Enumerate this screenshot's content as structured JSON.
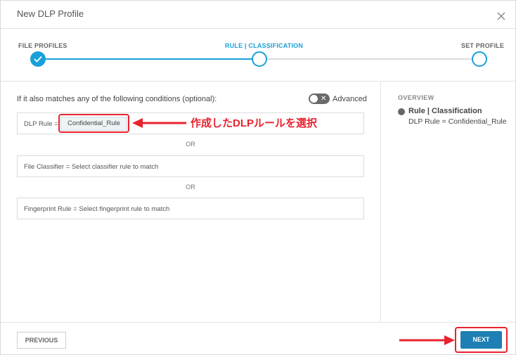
{
  "dialog": {
    "title": "New DLP Profile"
  },
  "stepper": {
    "steps": [
      {
        "label": "FILE PROFILES",
        "state": "done"
      },
      {
        "label": "RULE | CLASSIFICATION",
        "state": "current"
      },
      {
        "label": "SET PROFILE",
        "state": "todo"
      }
    ]
  },
  "conditions": {
    "heading": "If it also matches any of the following conditions (optional):",
    "advanced_label": "Advanced",
    "advanced_on": false,
    "dlp_rule_label": "DLP Rule =",
    "dlp_rule_value": "Confidential_Rule",
    "or_label": "OR",
    "file_classifier": "File Classifier = Select classifier rule to match",
    "fingerprint_rule": "Fingerprint Rule = Select fingerprint rule to match"
  },
  "annotation": {
    "text": "作成したDLPルールを選択",
    "color": "#e8232f"
  },
  "overview": {
    "title": "OVERVIEW",
    "heading": "Rule | Classification",
    "value": "DLP Rule = Confidential_Rule"
  },
  "footer": {
    "previous_label": "PREVIOUS",
    "next_label": "NEXT"
  },
  "colors": {
    "accent": "#1aa0d8",
    "primary_button": "#1d7fb3",
    "annotation": "#e8232f"
  }
}
